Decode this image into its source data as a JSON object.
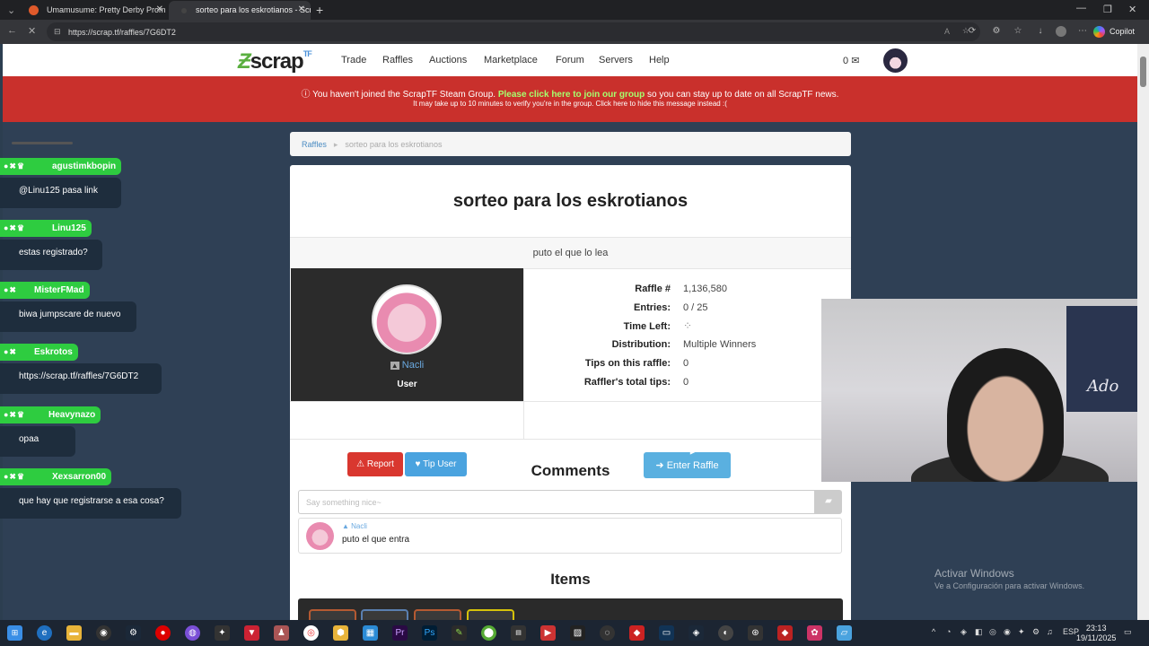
{
  "browser": {
    "tabs": [
      {
        "title": "Umamusume: Pretty Derby Prom",
        "active": false
      },
      {
        "title": "sorteo para los eskrotianos - Scr",
        "active": true
      }
    ],
    "url": "https://scrap.tf/raffles/7G6DT2",
    "copilot_label": "Copilot"
  },
  "site": {
    "brand": "scrap",
    "brand_suffix": "TF",
    "nav": [
      "Trade",
      "Raffles",
      "Auctions",
      "Marketplace",
      "Forum",
      "Servers",
      "Help"
    ],
    "cart_count": "0",
    "banner": {
      "line1_pre": "You haven't joined the ScrapTF Steam Group.",
      "line1_link": "Please click here to join our group",
      "line1_post": "so you can stay up to date on all ScrapTF news.",
      "line2_pre": "It may take up to 10 minutes to verify you're in the group. Click",
      "line2_link": "here",
      "line2_post": "to hide this message instead :("
    }
  },
  "chat": [
    {
      "user": "agustimkbopin",
      "message": "@Linu125 pasa link"
    },
    {
      "user": "Linu125",
      "message": "estas registrado?"
    },
    {
      "user": "MisterFMad",
      "message": "biwa jumpscare de nuevo"
    },
    {
      "user": "Eskrotos",
      "message": "https://scrap.tf/raffles/7G6DT2"
    },
    {
      "user": "Heavynazo",
      "message": "opaa"
    },
    {
      "user": "Xexsarron00",
      "message": "que hay que registrarse a esa cosa?"
    }
  ],
  "breadcrumb": {
    "root": "Raffles",
    "current": "sorteo para los eskrotianos"
  },
  "raffle": {
    "title": "sorteo para los eskrotianos",
    "message": "puto el que lo lea",
    "host_name": "Nacli",
    "host_role": "User",
    "stats": [
      {
        "label": "Raffle #",
        "value": "1,136,580"
      },
      {
        "label": "Entries:",
        "value": "0 / 25"
      },
      {
        "label": "Time Left:",
        "value": ""
      },
      {
        "label": "Distribution:",
        "value": "Multiple Winners"
      },
      {
        "label": "Tips on this raffle:",
        "value": "0"
      },
      {
        "label": "Raffler's total tips:",
        "value": "0"
      }
    ],
    "report_label": "Report",
    "tip_label": "Tip User",
    "enter_label": "Enter Raffle",
    "report_color": "#d9372f",
    "tip_color": "#4aa3df",
    "enter_color": "#5ab0e0"
  },
  "comments": {
    "heading": "Comments",
    "placeholder": "Say something nice~",
    "items": [
      {
        "user": "Nacli",
        "text": "puto el que entra"
      }
    ]
  },
  "items": {
    "heading": "Items"
  },
  "windows_activation": {
    "title": "Activar Windows",
    "subtitle": "Ve a Configuración para activar Windows."
  },
  "webcam": {
    "poster_text": "Ado"
  },
  "taskbar": {
    "language": "ESP",
    "time": "23:13",
    "date": "19/11/2025"
  }
}
